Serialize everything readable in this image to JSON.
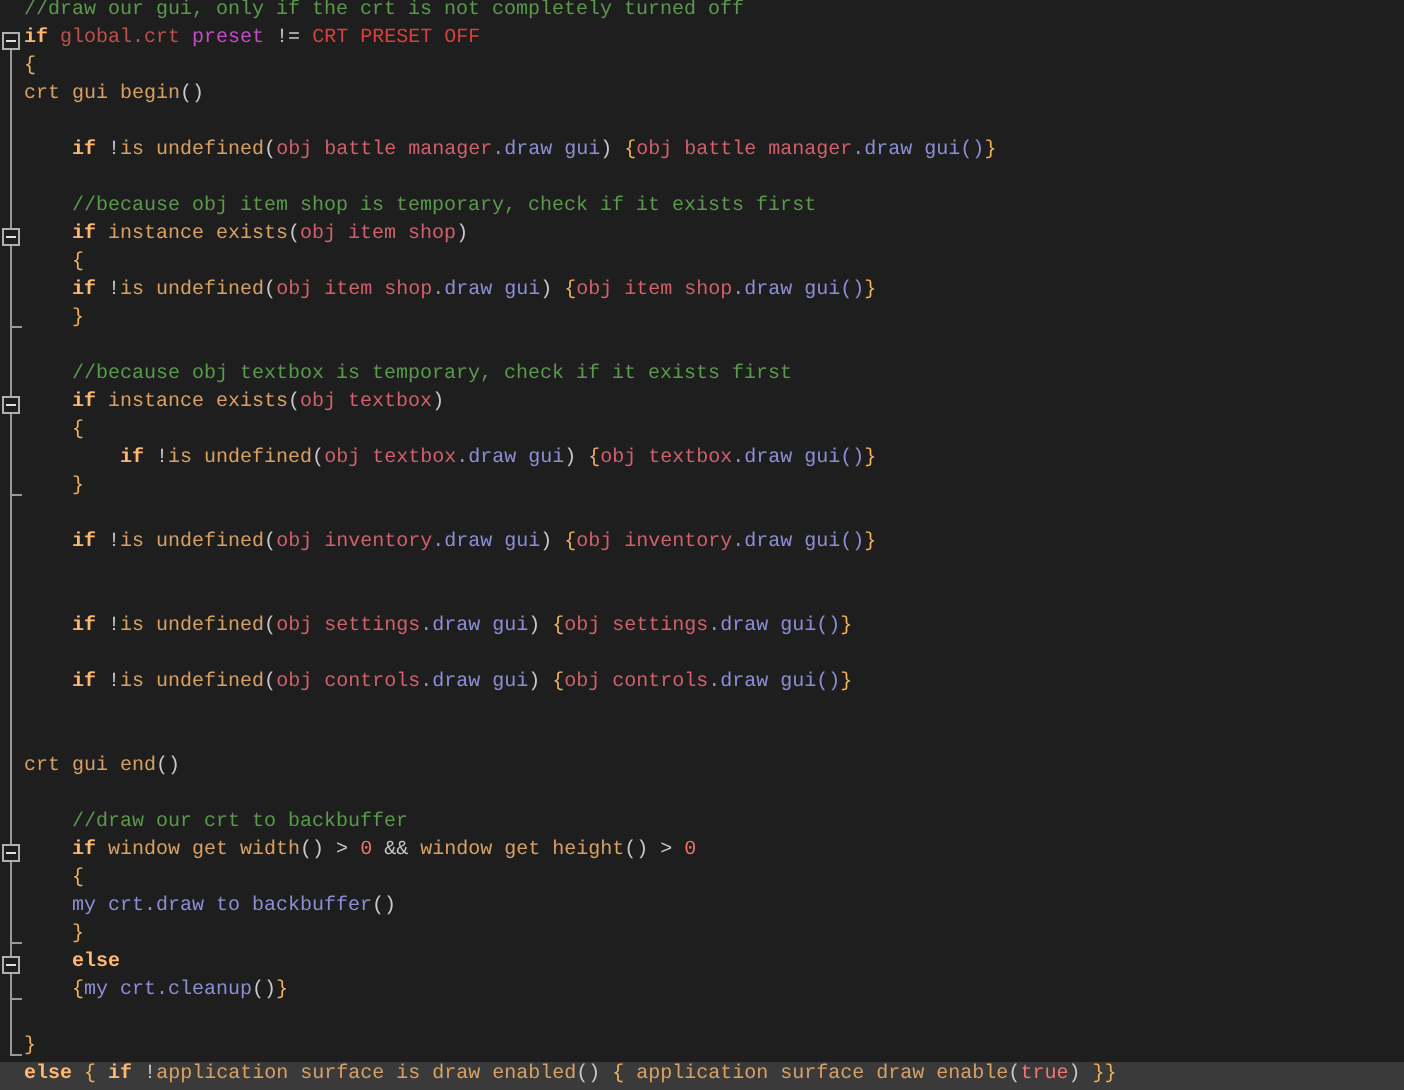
{
  "editor": {
    "lines": [
      {
        "current": false,
        "tokens": [
          {
            "kind": "comment",
            "text": "//draw our gui, only if the crt is not completely turned off"
          }
        ]
      },
      {
        "current": false,
        "expanded": true,
        "tokens": [
          {
            "kind": "keyword",
            "text": "if"
          },
          {
            "kind": "global",
            "text": " global.crt"
          },
          {
            "kind": "field",
            "text": " preset"
          },
          {
            "kind": "punct",
            "text": " != "
          },
          {
            "kind": "macro",
            "text": "CRT PRESET OFF"
          }
        ],
        "children": [
          {
            "current": false,
            "tokens": [
              {
                "kind": "brace",
                "text": "{"
              }
            ]
          },
          {
            "current": false,
            "tokens": [
              {
                "kind": "func",
                "text": "crt gui begin"
              },
              {
                "kind": "punct",
                "text": "()"
              }
            ]
          },
          {
            "current": false
          },
          {
            "current": false,
            "tokens": [
              {
                "kind": "keyword",
                "text": "    if"
              },
              {
                "kind": "punct",
                "text": " !"
              },
              {
                "kind": "func",
                "text": "is undefined"
              },
              {
                "kind": "punct",
                "text": "("
              },
              {
                "kind": "object",
                "text": "obj battle manager"
              },
              {
                "kind": "member",
                "text": ".draw gui"
              },
              {
                "kind": "punct",
                "text": ") "
              },
              {
                "kind": "brace",
                "text": "{"
              },
              {
                "kind": "object",
                "text": "obj battle manager"
              },
              {
                "kind": "member",
                "text": ".draw gui()"
              },
              {
                "kind": "brace",
                "text": "}"
              }
            ]
          },
          {
            "current": false
          },
          {
            "current": false,
            "tokens": [
              {
                "kind": "comment",
                "text": "    //because obj item shop is temporary, check if it exists first"
              }
            ]
          },
          {
            "current": false,
            "expanded": true,
            "tokens": [
              {
                "kind": "keyword",
                "text": "    if"
              },
              {
                "kind": "func",
                "text": " instance exists"
              },
              {
                "kind": "punct",
                "text": "("
              },
              {
                "kind": "object",
                "text": "obj item shop"
              },
              {
                "kind": "punct",
                "text": ")"
              }
            ],
            "children": [
              {
                "current": false,
                "tokens": [
                  {
                    "kind": "brace",
                    "text": "    {"
                  }
                ]
              },
              {
                "current": false,
                "tokens": [
                  {
                    "kind": "keyword",
                    "text": "    if"
                  },
                  {
                    "kind": "punct",
                    "text": " !"
                  },
                  {
                    "kind": "func",
                    "text": "is undefined"
                  },
                  {
                    "kind": "punct",
                    "text": "("
                  },
                  {
                    "kind": "object",
                    "text": "obj item shop"
                  },
                  {
                    "kind": "member",
                    "text": ".draw gui"
                  },
                  {
                    "kind": "punct",
                    "text": ") "
                  },
                  {
                    "kind": "brace",
                    "text": "{"
                  },
                  {
                    "kind": "object",
                    "text": "obj item shop"
                  },
                  {
                    "kind": "member",
                    "text": ".draw gui()"
                  },
                  {
                    "kind": "brace",
                    "text": "}"
                  }
                ]
              },
              {
                "current": false,
                "tokens": [
                  {
                    "kind": "brace",
                    "text": "    }"
                  }
                ]
              }
            ]
          },
          {
            "current": false
          },
          {
            "current": false,
            "tokens": [
              {
                "kind": "comment",
                "text": "    //because obj textbox is temporary, check if it exists first"
              }
            ]
          },
          {
            "current": false,
            "expanded": true,
            "tokens": [
              {
                "kind": "keyword",
                "text": "    if"
              },
              {
                "kind": "func",
                "text": " instance exists"
              },
              {
                "kind": "punct",
                "text": "("
              },
              {
                "kind": "object",
                "text": "obj textbox"
              },
              {
                "kind": "punct",
                "text": ")"
              }
            ],
            "children": [
              {
                "current": false,
                "tokens": [
                  {
                    "kind": "brace",
                    "text": "    {"
                  }
                ]
              },
              {
                "current": false,
                "tokens": [
                  {
                    "kind": "keyword",
                    "text": "        if"
                  },
                  {
                    "kind": "punct",
                    "text": " !"
                  },
                  {
                    "kind": "func",
                    "text": "is undefined"
                  },
                  {
                    "kind": "punct",
                    "text": "("
                  },
                  {
                    "kind": "object",
                    "text": "obj textbox"
                  },
                  {
                    "kind": "member",
                    "text": ".draw gui"
                  },
                  {
                    "kind": "punct",
                    "text": ") "
                  },
                  {
                    "kind": "brace",
                    "text": "{"
                  },
                  {
                    "kind": "object",
                    "text": "obj textbox"
                  },
                  {
                    "kind": "member",
                    "text": ".draw gui()"
                  },
                  {
                    "kind": "brace",
                    "text": "}"
                  }
                ]
              },
              {
                "current": false,
                "tokens": [
                  {
                    "kind": "brace",
                    "text": "    }"
                  }
                ]
              }
            ]
          },
          {
            "current": false
          },
          {
            "current": false,
            "tokens": [
              {
                "kind": "keyword",
                "text": "    if"
              },
              {
                "kind": "punct",
                "text": " !"
              },
              {
                "kind": "func",
                "text": "is undefined"
              },
              {
                "kind": "punct",
                "text": "("
              },
              {
                "kind": "object",
                "text": "obj inventory"
              },
              {
                "kind": "member",
                "text": ".draw gui"
              },
              {
                "kind": "punct",
                "text": ") "
              },
              {
                "kind": "brace",
                "text": "{"
              },
              {
                "kind": "object",
                "text": "obj inventory"
              },
              {
                "kind": "member",
                "text": ".draw gui()"
              },
              {
                "kind": "brace",
                "text": "}"
              }
            ]
          },
          {
            "current": false
          },
          {
            "current": false
          },
          {
            "current": false,
            "tokens": [
              {
                "kind": "keyword",
                "text": "    if"
              },
              {
                "kind": "punct",
                "text": " !"
              },
              {
                "kind": "func",
                "text": "is undefined"
              },
              {
                "kind": "punct",
                "text": "("
              },
              {
                "kind": "object",
                "text": "obj settings"
              },
              {
                "kind": "member",
                "text": ".draw gui"
              },
              {
                "kind": "punct",
                "text": ") "
              },
              {
                "kind": "brace",
                "text": "{"
              },
              {
                "kind": "object",
                "text": "obj settings"
              },
              {
                "kind": "member",
                "text": ".draw gui()"
              },
              {
                "kind": "brace",
                "text": "}"
              }
            ]
          },
          {
            "current": false
          },
          {
            "current": false,
            "tokens": [
              {
                "kind": "keyword",
                "text": "    if"
              },
              {
                "kind": "punct",
                "text": " !"
              },
              {
                "kind": "func",
                "text": "is undefined"
              },
              {
                "kind": "punct",
                "text": "("
              },
              {
                "kind": "object",
                "text": "obj controls"
              },
              {
                "kind": "member",
                "text": ".draw gui"
              },
              {
                "kind": "punct",
                "text": ") "
              },
              {
                "kind": "brace",
                "text": "{"
              },
              {
                "kind": "object",
                "text": "obj controls"
              },
              {
                "kind": "member",
                "text": ".draw gui()"
              },
              {
                "kind": "brace",
                "text": "}"
              }
            ]
          },
          {
            "current": false
          },
          {
            "current": false
          },
          {
            "current": false,
            "tokens": [
              {
                "kind": "func",
                "text": "crt gui end"
              },
              {
                "kind": "punct",
                "text": "()"
              }
            ]
          },
          {
            "current": false
          },
          {
            "current": false,
            "tokens": [
              {
                "kind": "comment",
                "text": "    //draw our crt to backbuffer"
              }
            ]
          },
          {
            "current": false,
            "expanded": true,
            "tokens": [
              {
                "kind": "keyword",
                "text": "    if"
              },
              {
                "kind": "func",
                "text": " window get width"
              },
              {
                "kind": "punct",
                "text": "() > "
              },
              {
                "kind": "number",
                "text": "0"
              },
              {
                "kind": "punct",
                "text": " && "
              },
              {
                "kind": "func",
                "text": "window get height"
              },
              {
                "kind": "punct",
                "text": "() > "
              },
              {
                "kind": "number",
                "text": "0"
              }
            ],
            "children": [
              {
                "current": false,
                "tokens": [
                  {
                    "kind": "brace",
                    "text": "    {"
                  }
                ]
              },
              {
                "current": false,
                "tokens": [
                  {
                    "kind": "member",
                    "text": "    my crt.draw to backbuffer"
                  },
                  {
                    "kind": "punct",
                    "text": "()"
                  }
                ]
              },
              {
                "current": false,
                "tokens": [
                  {
                    "kind": "brace",
                    "text": "    }"
                  }
                ]
              }
            ]
          },
          {
            "current": false,
            "expanded": true,
            "tokens": [
              {
                "kind": "keyword",
                "text": "    else"
              }
            ],
            "children": [
              {
                "current": false,
                "tokens": [
                  {
                    "kind": "brace",
                    "text": "    {"
                  },
                  {
                    "kind": "member",
                    "text": "my crt.cleanup"
                  },
                  {
                    "kind": "punct",
                    "text": "()"
                  },
                  {
                    "kind": "brace",
                    "text": "}"
                  }
                ]
              }
            ]
          },
          {
            "current": false
          },
          {
            "current": false,
            "tokens": [
              {
                "kind": "brace",
                "text": "}"
              }
            ]
          }
        ]
      },
      {
        "current": true,
        "tokens": [
          {
            "kind": "keyword",
            "text": "else"
          },
          {
            "kind": "brace",
            "text": " { "
          },
          {
            "kind": "keyword",
            "text": "if"
          },
          {
            "kind": "punct",
            "text": " !"
          },
          {
            "kind": "func",
            "text": "application surface is draw enabled"
          },
          {
            "kind": "punct",
            "text": "() "
          },
          {
            "kind": "brace",
            "text": "{ "
          },
          {
            "kind": "func",
            "text": "application surface draw enable"
          },
          {
            "kind": "punct",
            "text": "("
          },
          {
            "kind": "number",
            "text": "true"
          },
          {
            "kind": "punct",
            "text": ") "
          },
          {
            "kind": "brace",
            "text": "}}"
          }
        ]
      }
    ]
  }
}
